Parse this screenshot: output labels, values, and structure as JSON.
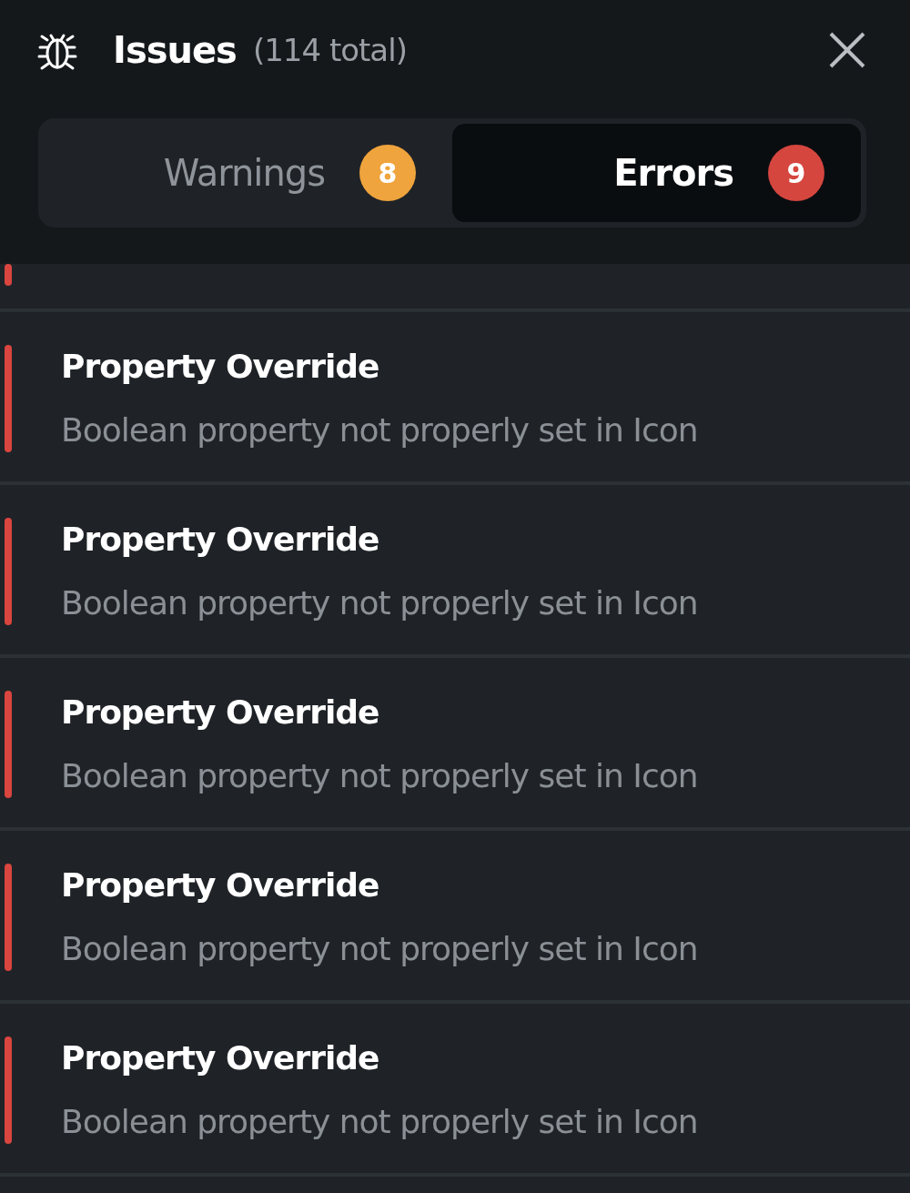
{
  "header": {
    "title": "Issues",
    "total": "(114 total)"
  },
  "tabs": [
    {
      "label": "Warnings",
      "count": "8",
      "color": "#efa43d",
      "selected": false
    },
    {
      "label": "Errors",
      "count": "9",
      "color": "#d5463f",
      "selected": true
    }
  ],
  "issues": [
    {
      "title": "Property Override",
      "description": "Boolean property not properly set in Icon"
    },
    {
      "title": "Property Override",
      "description": "Boolean property not properly set in Icon"
    },
    {
      "title": "Property Override",
      "description": "Boolean property not properly set in Icon"
    },
    {
      "title": "Property Override",
      "description": "Boolean property not properly set in Icon"
    },
    {
      "title": "Property Override",
      "description": "Boolean property not properly set in Icon"
    }
  ]
}
